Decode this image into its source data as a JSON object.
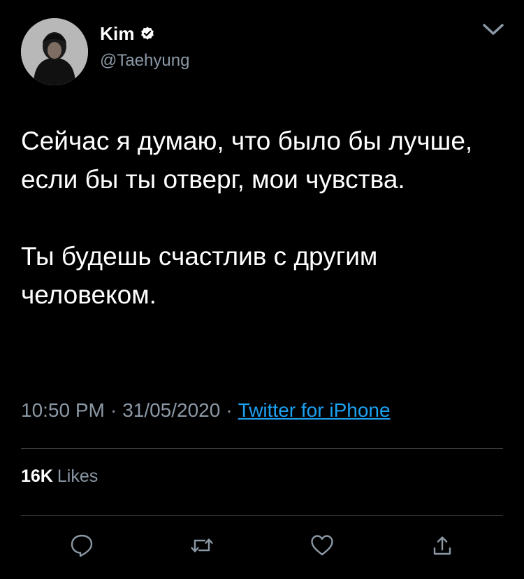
{
  "user": {
    "name": "Kim",
    "handle": "@Taehyung",
    "verified": true
  },
  "tweet": {
    "paragraphs": [
      "Сейчас я думаю, что было бы лучше, если бы ты отверг, мои чувства.",
      "Ты будешь счастлив с другим человеком."
    ],
    "time": "10:50 PM",
    "date": "31/05/2020",
    "separator": "·",
    "source": "Twitter for iPhone"
  },
  "stats": {
    "likes_count": "16K",
    "likes_label": "Likes"
  },
  "actions": {
    "reply_icon": "reply-icon",
    "retweet_icon": "retweet-icon",
    "like_icon": "heart-icon",
    "share_icon": "share-icon"
  },
  "colors": {
    "background": "#000000",
    "text": "#ffffff",
    "secondary_text": "#8b98a5",
    "link": "#1da1f2",
    "divider": "#3d4248",
    "icon": "#8b98a5"
  }
}
